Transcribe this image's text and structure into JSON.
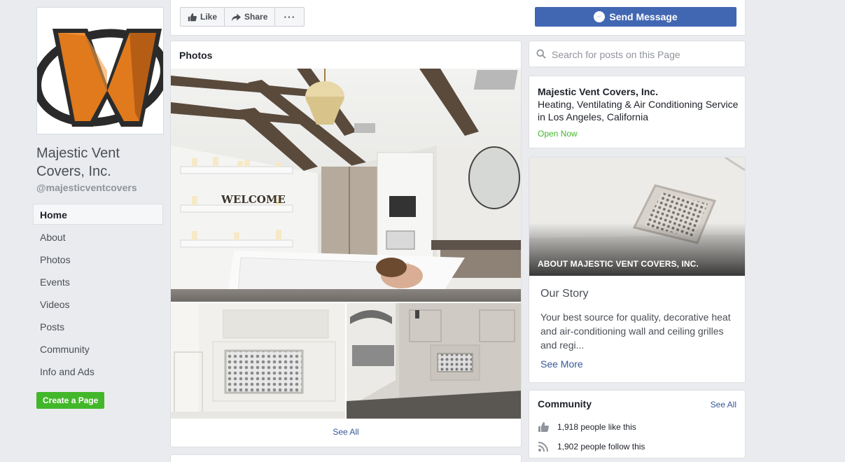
{
  "page": {
    "name": "Majestic Vent Covers, Inc.",
    "handle": "@majesticventcovers"
  },
  "nav": {
    "items": [
      {
        "label": "Home"
      },
      {
        "label": "About"
      },
      {
        "label": "Photos"
      },
      {
        "label": "Events"
      },
      {
        "label": "Videos"
      },
      {
        "label": "Posts"
      },
      {
        "label": "Community"
      },
      {
        "label": "Info and Ads"
      }
    ],
    "active": "Home",
    "create_page_label": "Create a Page"
  },
  "actions": {
    "like_label": "Like",
    "share_label": "Share",
    "more_label": "···",
    "send_message_label": "Send Message"
  },
  "photos": {
    "title": "Photos",
    "see_all_label": "See All",
    "sign_text": "WELCOME"
  },
  "search": {
    "placeholder": "Search for posts on this Page"
  },
  "info": {
    "name": "Majestic Vent Covers, Inc.",
    "category": "Heating, Ventilating & Air Conditioning Service in Los Angeles, California",
    "status": "Open Now"
  },
  "about": {
    "overlay_title": "ABOUT MAJESTIC VENT COVERS, INC.",
    "story_title": "Our Story",
    "story_body": "Your best source for quality, decorative heat and air-conditioning wall and ceiling grilles and regi...",
    "see_more_label": "See More"
  },
  "community": {
    "title": "Community",
    "see_all_label": "See All",
    "likes_text": "1,918 people like this",
    "follows_text": "1,902 people follow this"
  },
  "colors": {
    "background": "#e9ebee",
    "brand_blue": "#4267b2",
    "link_blue": "#365899",
    "green": "#42b72a",
    "logo_orange": "#e07a1c"
  }
}
